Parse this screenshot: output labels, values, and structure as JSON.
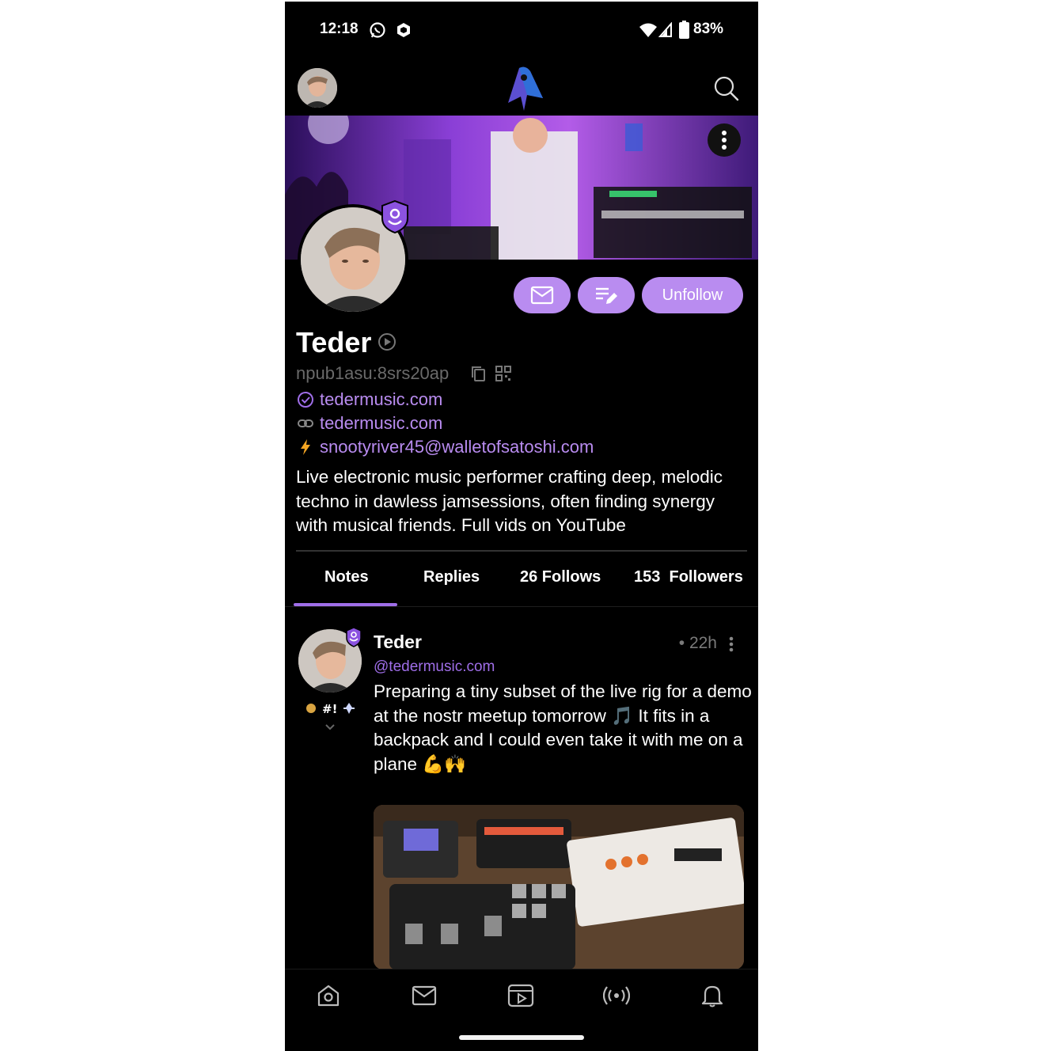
{
  "status_bar": {
    "time": "12:18",
    "battery": "83%"
  },
  "profile": {
    "name": "Teder",
    "npub": "npub1asu:8srs20ap",
    "nip05": "tedermusic.com",
    "website": "tedermusic.com",
    "lightning": "snootyriver45@walletofsatoshi.com",
    "bio": "Live electronic music performer crafting deep, melodic techno in dawless jamsessions, often finding synergy with musical friends. Full vids on YouTube",
    "unfollow_label": "Unfollow"
  },
  "tabs": [
    {
      "label": "Notes"
    },
    {
      "label": "Replies"
    },
    {
      "label": "26 Follows"
    },
    {
      "label": "153  Followers"
    }
  ],
  "post": {
    "author": "Teder",
    "nip05": "@tedermusic.com",
    "time": "• 22h",
    "text": "Preparing a tiny subset of the live rig for a demo at the nostr meetup tomorrow 🎵 It fits in a backpack and I could even take it with me on a plane 💪🙌"
  },
  "colors": {
    "accent": "#b98cf0",
    "accent_dark": "#9f6ee8",
    "background": "#000000"
  }
}
